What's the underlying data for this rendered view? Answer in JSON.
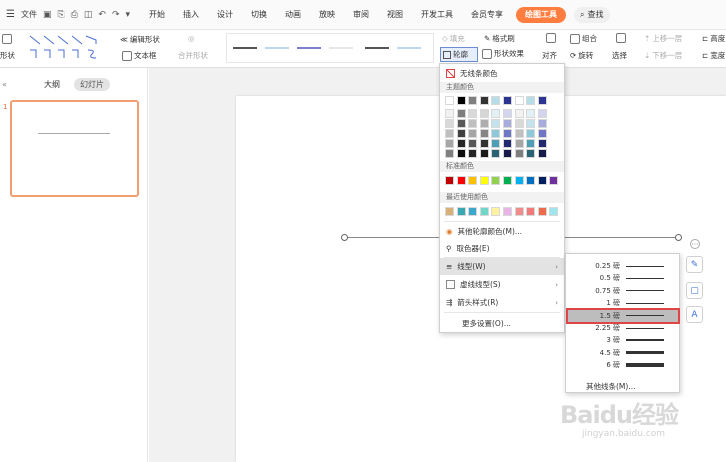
{
  "menubar": {
    "file_label": "文件",
    "tabs": [
      "开始",
      "插入",
      "设计",
      "切换",
      "动画",
      "放映",
      "审阅",
      "视图",
      "开发工具",
      "会员专享"
    ],
    "active_tab": "绘图工具",
    "search_label": "查找"
  },
  "ribbon": {
    "shape_label": "形状",
    "edit_shape": "编辑形状",
    "text_box": "文本框",
    "merge_shape": "合并形状",
    "fill": "填充",
    "format_painter": "格式刷",
    "outline": "轮廓",
    "shape_effect": "形状效果",
    "align": "对齐",
    "group": "组合",
    "rotate": "旋转",
    "select": "选择",
    "bring_forward": "上移一层",
    "send_backward": "下移一层",
    "high": "高度",
    "width": "宽度"
  },
  "left_pane": {
    "tab_outline": "大纲",
    "tab_slides": "幻灯片",
    "slide_number": "1"
  },
  "outline_menu": {
    "no_line": "无线条颜色",
    "theme_colors": "主题颜色",
    "standard_colors": "标准颜色",
    "recent_colors": "最近使用颜色",
    "more_colors": "其他轮廓颜色(M)...",
    "eyedropper": "取色器(E)",
    "line_style": "线型(W)",
    "dash_style": "虚线线型(S)",
    "arrow_style": "箭头样式(R)",
    "more_settings": "更多设置(O)...",
    "theme_top_row": [
      "#ffffff",
      "#000000",
      "#7f7f7f",
      "#333333",
      "#b7dde8",
      "#2d3592",
      "#ffffff",
      "#b7dde8",
      "#2d3592"
    ],
    "theme_columns": [
      [
        "#f2f2f2",
        "#d9d9d9",
        "#bfbfbf",
        "#a6a6a6",
        "#7f7f7f"
      ],
      [
        "#7f7f7f",
        "#595959",
        "#404040",
        "#262626",
        "#0d0d0d"
      ],
      [
        "#d9d9d9",
        "#bfbfbf",
        "#a6a6a6",
        "#595959",
        "#262626"
      ],
      [
        "#d6d6d6",
        "#adadad",
        "#858585",
        "#333333",
        "#1a1a1a"
      ],
      [
        "#e2f1f5",
        "#c5e3ec",
        "#8ec9d9",
        "#4e9fb5",
        "#2a6474"
      ],
      [
        "#d3d5ee",
        "#a7acdd",
        "#6f76c4",
        "#23296f",
        "#171b4a"
      ],
      [
        "#f2f2f2",
        "#d9d9d9",
        "#bfbfbf",
        "#a6a6a6",
        "#7f7f7f"
      ],
      [
        "#e2f1f5",
        "#c5e3ec",
        "#8ec9d9",
        "#4e9fb5",
        "#2a6474"
      ],
      [
        "#d3d5ee",
        "#a7acdd",
        "#6f76c4",
        "#23296f",
        "#171b4a"
      ]
    ],
    "standard_swatches": [
      "#c00000",
      "#ff0000",
      "#ffc000",
      "#ffff00",
      "#92d050",
      "#00b050",
      "#00b0f0",
      "#0070c0",
      "#002060",
      "#7030a0"
    ],
    "recent_swatches": [
      "#d8b17a",
      "#3aa8b4",
      "#3fa7c9",
      "#6fd6c8",
      "#fff2a0",
      "#e9b5e6",
      "#f08c8c",
      "#f07a7a",
      "#ee6a4c",
      "#9fe6ec"
    ]
  },
  "weight_menu": {
    "items": [
      {
        "label": "0.25 磅",
        "weight": 0.25
      },
      {
        "label": "0.5 磅",
        "weight": 0.5
      },
      {
        "label": "0.75 磅",
        "weight": 0.75
      },
      {
        "label": "1 磅",
        "weight": 1
      },
      {
        "label": "1.5 磅",
        "weight": 1.5
      },
      {
        "label": "2.25 磅",
        "weight": 2.25
      },
      {
        "label": "3 磅",
        "weight": 3
      },
      {
        "label": "4.5 磅",
        "weight": 4.5
      },
      {
        "label": "6 磅",
        "weight": 6
      }
    ],
    "selected_label": "1.5 磅",
    "more_lines": "其他线条(M)..."
  },
  "watermark": {
    "logo": "Baidu经验",
    "url": "jingyan.baidu.com"
  },
  "colors": {
    "accent": "#ff7e3f",
    "highlight_border": "#e04545"
  }
}
